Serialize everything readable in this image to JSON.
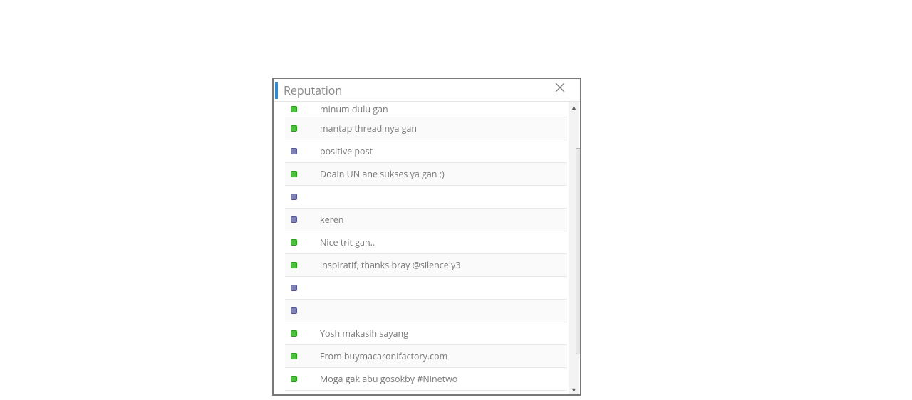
{
  "modal": {
    "title": "Reputation"
  },
  "rows": [
    {
      "badge": "green",
      "text": "minum dulu gan"
    },
    {
      "badge": "green",
      "text": "mantap thread nya gan"
    },
    {
      "badge": "grey",
      "text": "positive post"
    },
    {
      "badge": "green",
      "text": "Doain UN ane sukses ya gan ;)"
    },
    {
      "badge": "grey",
      "text": ""
    },
    {
      "badge": "grey",
      "text": "keren"
    },
    {
      "badge": "green",
      "text": "Nice trit gan.."
    },
    {
      "badge": "green",
      "text": "inspiratif, thanks bray @silencely3"
    },
    {
      "badge": "grey",
      "text": ""
    },
    {
      "badge": "grey",
      "text": ""
    },
    {
      "badge": "green",
      "text": "Yosh makasih sayang"
    },
    {
      "badge": "green",
      "text": "From buymacaronifactory.com"
    },
    {
      "badge": "green",
      "text": "Moga gak abu gosokby #Ninetwo"
    }
  ]
}
